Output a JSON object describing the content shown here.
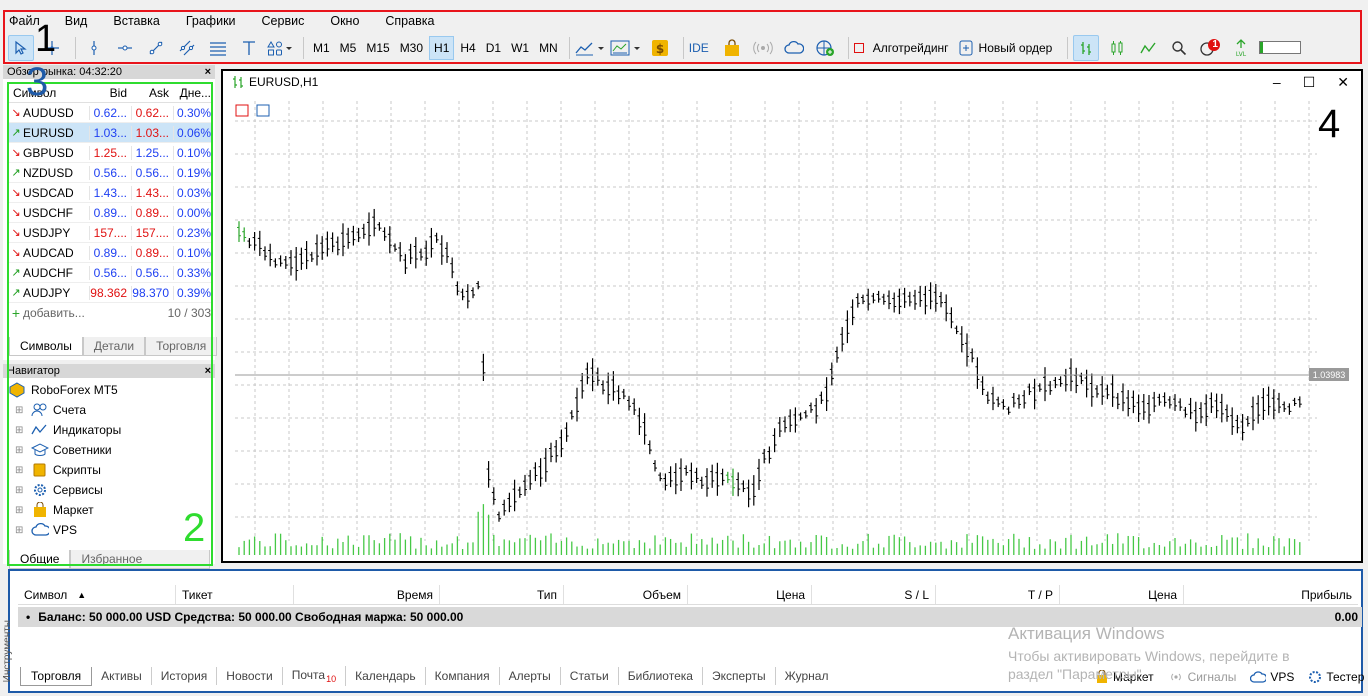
{
  "menu": [
    "Файл",
    "Вид",
    "Вставка",
    "Графики",
    "Сервис",
    "Окно",
    "Справка"
  ],
  "toolbar": {
    "timeframes": [
      "M1",
      "M5",
      "M15",
      "M30",
      "H1",
      "H4",
      "D1",
      "W1",
      "MN"
    ],
    "selected_tf": "H1",
    "ide_label": "IDE",
    "algo_label": "Алготрейдинг",
    "new_order_label": "Новый ордер",
    "notification_count": "1"
  },
  "market_watch": {
    "title": "Обзор рынка: 04:32:20",
    "columns": [
      "Символ",
      "Bid",
      "Ask",
      "Дне..."
    ],
    "rows": [
      {
        "arrow": "↘",
        "dir": "down",
        "symbol": "AUDUSD",
        "bid": "0.62...",
        "ask": "0.62...",
        "change": "0.30%",
        "bid_color": "blue",
        "ask_color": "red"
      },
      {
        "arrow": "↗",
        "dir": "up",
        "symbol": "EURUSD",
        "bid": "1.03...",
        "ask": "1.03...",
        "change": "0.06%",
        "bid_color": "blue",
        "ask_color": "red"
      },
      {
        "arrow": "↘",
        "dir": "down",
        "symbol": "GBPUSD",
        "bid": "1.25...",
        "ask": "1.25...",
        "change": "0.10%",
        "bid_color": "red",
        "ask_color": "blue"
      },
      {
        "arrow": "↗",
        "dir": "up",
        "symbol": "NZDUSD",
        "bid": "0.56...",
        "ask": "0.56...",
        "change": "0.19%",
        "bid_color": "blue",
        "ask_color": "blue"
      },
      {
        "arrow": "↘",
        "dir": "down",
        "symbol": "USDCAD",
        "bid": "1.43...",
        "ask": "1.43...",
        "change": "0.03%",
        "bid_color": "blue",
        "ask_color": "red"
      },
      {
        "arrow": "↘",
        "dir": "down",
        "symbol": "USDCHF",
        "bid": "0.89...",
        "ask": "0.89...",
        "change": "0.00%",
        "bid_color": "blue",
        "ask_color": "red"
      },
      {
        "arrow": "↘",
        "dir": "down",
        "symbol": "USDJPY",
        "bid": "157....",
        "ask": "157....",
        "change": "0.23%",
        "bid_color": "red",
        "ask_color": "red"
      },
      {
        "arrow": "↘",
        "dir": "down",
        "symbol": "AUDCAD",
        "bid": "0.89...",
        "ask": "0.89...",
        "change": "0.10%",
        "bid_color": "blue",
        "ask_color": "red"
      },
      {
        "arrow": "↗",
        "dir": "up",
        "symbol": "AUDCHF",
        "bid": "0.56...",
        "ask": "0.56...",
        "change": "0.33%",
        "bid_color": "blue",
        "ask_color": "blue"
      },
      {
        "arrow": "↗",
        "dir": "up",
        "symbol": "AUDJPY",
        "bid": "98.362",
        "ask": "98.370",
        "change": "0.39%",
        "bid_color": "red",
        "ask_color": "blue"
      }
    ],
    "add_label": "добавить...",
    "count": "10 / 303",
    "tabs": [
      "Символы",
      "Детали",
      "Торговля"
    ]
  },
  "navigator": {
    "title": "Навигатор",
    "root": "RoboForex MT5",
    "items": [
      "Счета",
      "Индикаторы",
      "Советники",
      "Скрипты",
      "Сервисы",
      "Маркет",
      "VPS"
    ],
    "tabs": [
      "Общие",
      "Избранное"
    ]
  },
  "chart": {
    "title": "EURUSD,H1",
    "price_label": "1.03983"
  },
  "terminal": {
    "columns": [
      "Символ",
      "Тикет",
      "Время",
      "Тип",
      "Объем",
      "Цена",
      "S / L",
      "T / P",
      "Цена",
      "Прибыль"
    ],
    "balance_text": "Баланс: 50 000.00 USD  Средства: 50 000.00  Свободная маржа: 50 000.00",
    "profit": "0.00",
    "tabs": [
      "Торговля",
      "Активы",
      "История",
      "Новости",
      "Почта",
      "Календарь",
      "Компания",
      "Алерты",
      "Статьи",
      "Библиотека",
      "Эксперты",
      "Журнал"
    ],
    "mail_count": "10",
    "side_label": "Инструменты",
    "status_items": [
      "Маркет",
      "Сигналы",
      "VPS",
      "Тестер"
    ]
  },
  "watermark": {
    "line1": "Активация Windows",
    "line2": "Чтобы активировать Windows, перейдите в",
    "line3": "раздел \"Параметры\"."
  },
  "annotations": {
    "a1": "1",
    "a2": "2",
    "a3": "3",
    "a4": "4"
  },
  "colors": {
    "red_box": "#e8141b",
    "green_box": "#2fdc2f",
    "blue_box": "#1e5aa8",
    "selected": "#cce4f7"
  }
}
